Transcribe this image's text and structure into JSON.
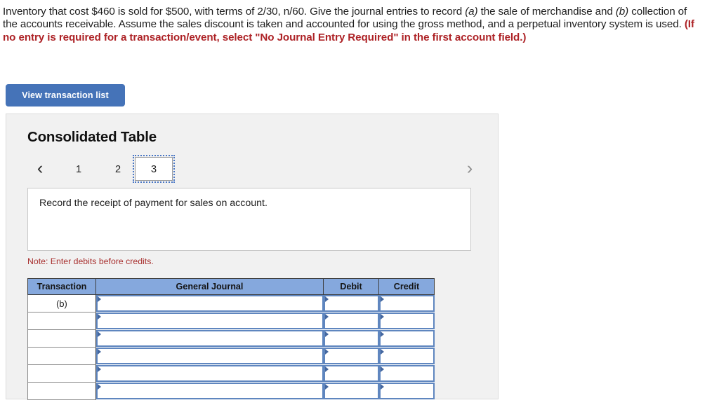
{
  "problem": {
    "segments": [
      {
        "text": "Inventory that cost $460 is sold for $500, with terms of 2/30, n/60. Give the journal entries to record ",
        "style": "normal"
      },
      {
        "text": "(a)",
        "style": "italic"
      },
      {
        "text": " the sale of merchandise and ",
        "style": "normal"
      },
      {
        "text": "(b)",
        "style": "italic"
      },
      {
        "text": " collection of the accounts receivable. Assume the sales discount is taken and accounted for using the gross method, and a perpetual inventory system is used. ",
        "style": "normal"
      },
      {
        "text": "(If no entry is required for a transaction/event, select \"No Journal Entry Required\" in the first account field.)",
        "style": "bold-red"
      }
    ],
    "full_text": "Inventory that cost $460 is sold for $500, with terms of 2/30, n/60. Give the journal entries to record (a) the sale of merchandise and (b) collection of the accounts receivable. Assume the sales discount is taken and accounted for using the gross method, and a perpetual inventory system is used. (If no entry is required for a transaction/event, select \"No Journal Entry Required\" in the first account field.)"
  },
  "toolbar": {
    "view_transaction_list_label": "View transaction list"
  },
  "panel": {
    "title": "Consolidated Table",
    "pager": {
      "prev_icon": "chevron-left-icon",
      "prev_glyph": "‹",
      "next_icon": "chevron-right-icon",
      "next_glyph": "›",
      "tabs": [
        {
          "label": "1",
          "active": false
        },
        {
          "label": "2",
          "active": false
        },
        {
          "label": "3",
          "active": true
        }
      ]
    },
    "description": "Record the receipt of payment for sales on account.",
    "note": "Note: Enter debits before credits."
  },
  "journal": {
    "headers": [
      "Transaction",
      "General Journal",
      "Debit",
      "Credit"
    ],
    "rows": [
      {
        "transaction": "(b)",
        "general_journal": "",
        "debit": "",
        "credit": ""
      },
      {
        "transaction": "",
        "general_journal": "",
        "debit": "",
        "credit": ""
      },
      {
        "transaction": "",
        "general_journal": "",
        "debit": "",
        "credit": ""
      },
      {
        "transaction": "",
        "general_journal": "",
        "debit": "",
        "credit": ""
      },
      {
        "transaction": "",
        "general_journal": "",
        "debit": "",
        "credit": ""
      },
      {
        "transaction": "",
        "general_journal": "",
        "debit": "",
        "credit": ""
      }
    ]
  },
  "colors": {
    "button_blue": "#4573b8",
    "header_blue": "#85a8dd",
    "input_border_blue": "#5f86bf",
    "note_red": "#a8302f",
    "emphasis_red": "#ad2226",
    "panel_gray": "#f1f1f1"
  }
}
